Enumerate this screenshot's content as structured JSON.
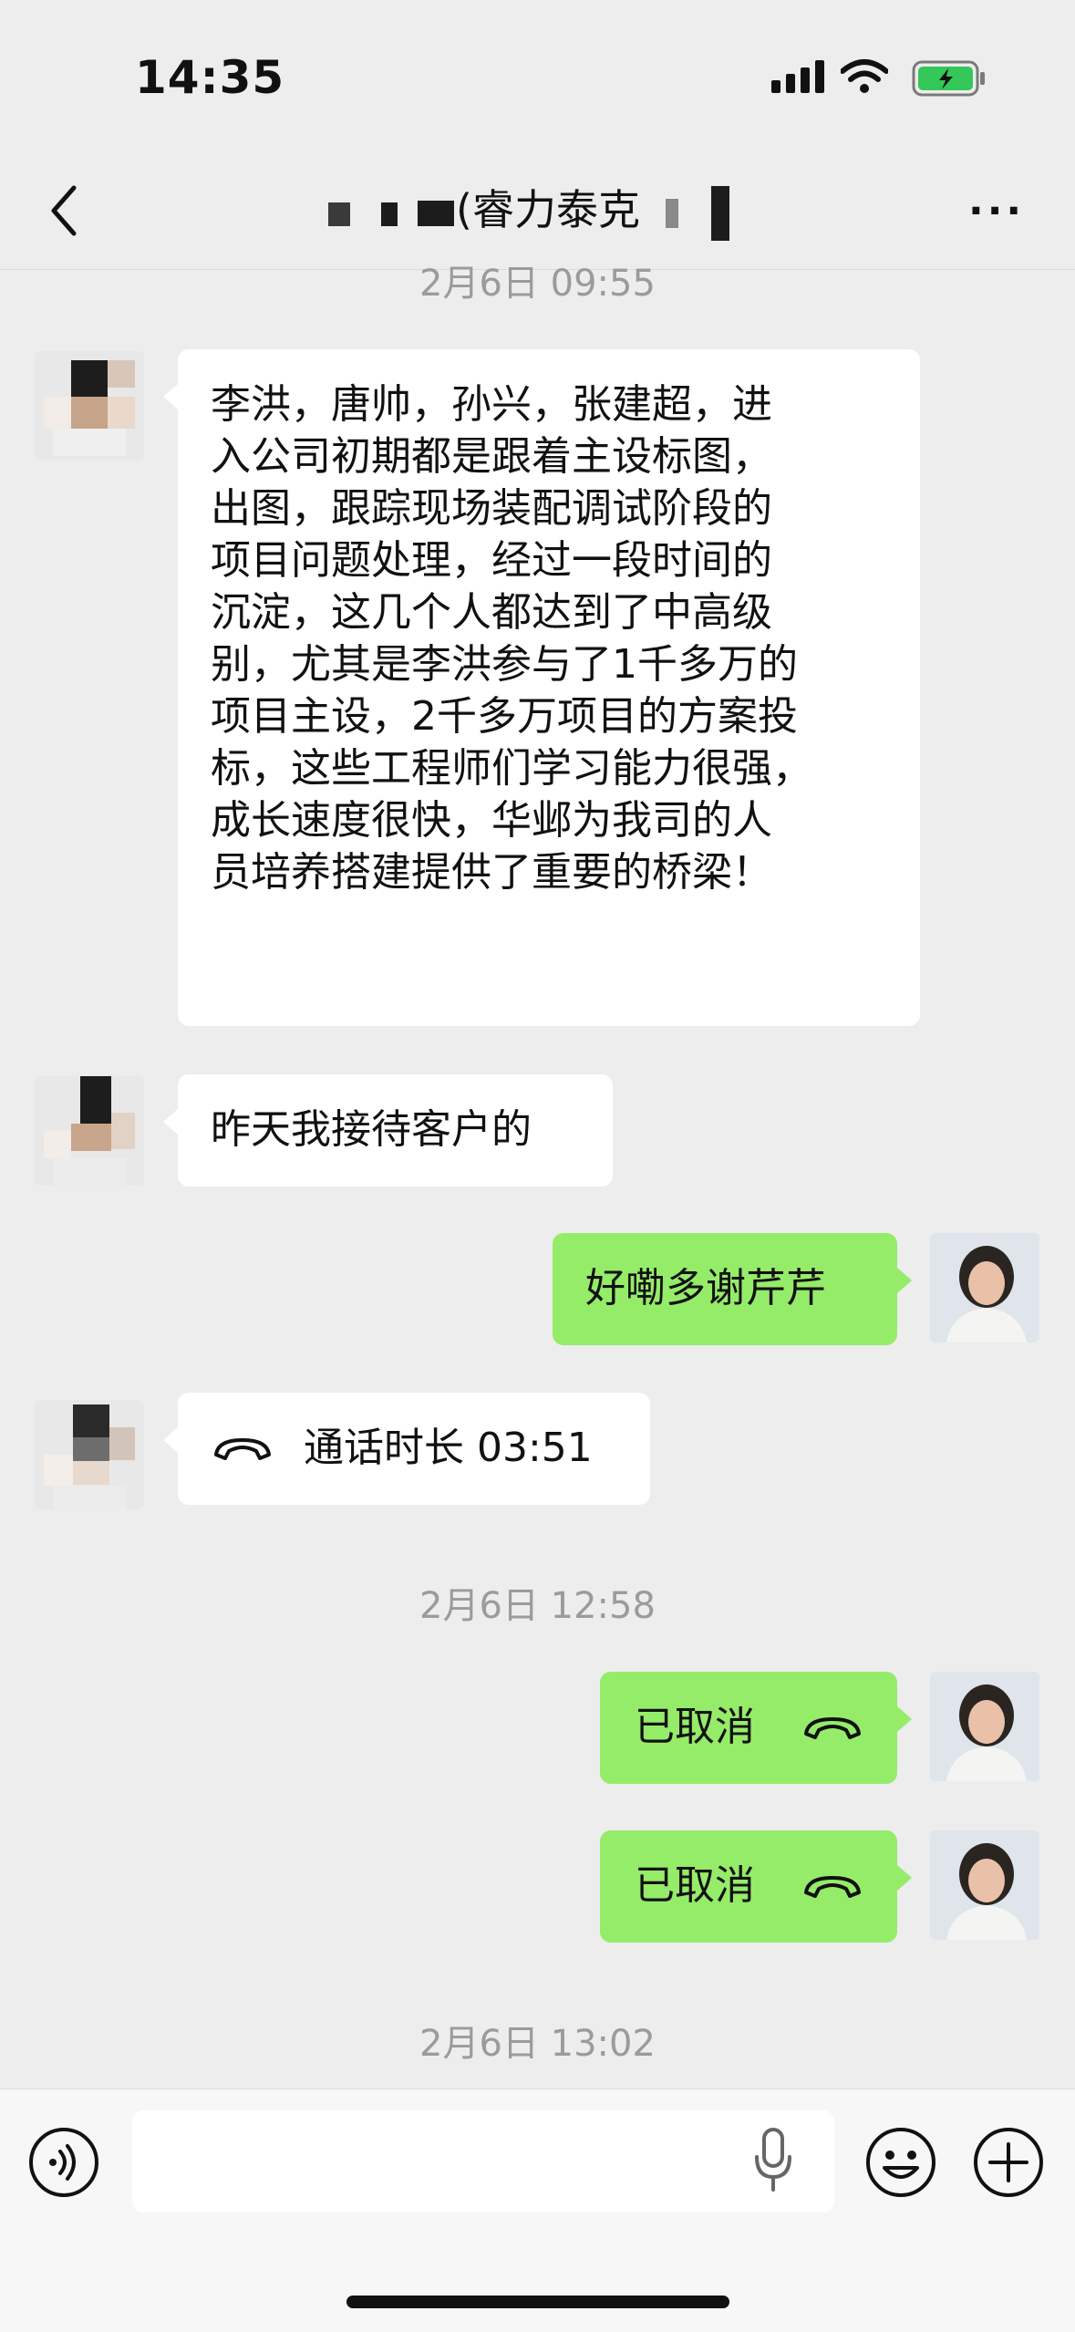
{
  "status_bar": {
    "time": "14:35"
  },
  "nav": {
    "title": "(睿力泰克"
  },
  "messages": {
    "timestamp_1": "2月6日 09:55",
    "msg_1": "李洪，唐帅，孙兴，张建超，进\n入公司初期都是跟着主设标图，\n出图，跟踪现场装配调试阶段的\n项目问题处理，经过一段时间的\n沉淀，这几个人都达到了中高级\n别，尤其是李洪参与了1千多万的\n项目主设，2千多万项目的方案投\n标，这些工程师们学习能力很强，\n成长速度很快，华邺为我司的人\n员培养搭建提供了重要的桥梁！",
    "msg_2": "昨天我接待客户的",
    "msg_3": "好嘞多谢芹芹",
    "call_1": "通话时长 03:51",
    "timestamp_2": "2月6日 12:58",
    "call_2": "已取消",
    "call_3": "已取消",
    "timestamp_3": "2月6日 13:02"
  },
  "input": {
    "placeholder": ""
  },
  "colors": {
    "background": "#ededed",
    "self_bubble": "#95ec69",
    "other_bubble": "#ffffff"
  },
  "icons": [
    "back-icon",
    "more-icon",
    "phone-icon",
    "voice-icon",
    "mic-icon",
    "emoji-icon",
    "plus-icon"
  ]
}
